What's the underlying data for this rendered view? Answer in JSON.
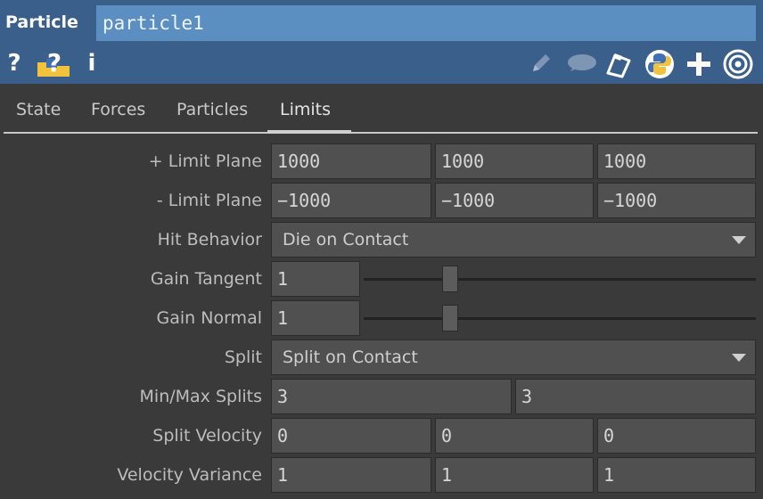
{
  "header": {
    "op_type": "Particle",
    "op_name": "particle1",
    "left_icons": [
      "help-icon",
      "python-help-icon",
      "info-icon"
    ],
    "right_icons": [
      "pencil-icon",
      "comment-icon",
      "clipboard-icon",
      "python-icon",
      "plus-icon",
      "target-icon"
    ],
    "help_glyph": "?",
    "info_glyph": "i"
  },
  "tabs": [
    "State",
    "Forces",
    "Particles",
    "Limits"
  ],
  "active_tab": "Limits",
  "params": {
    "limit_plane_pos": {
      "label": "+ Limit Plane",
      "values": [
        "1000",
        "1000",
        "1000"
      ]
    },
    "limit_plane_neg": {
      "label": "- Limit Plane",
      "values": [
        "−1000",
        "−1000",
        "−1000"
      ]
    },
    "hit_behavior": {
      "label": "Hit Behavior",
      "value": "Die on Contact"
    },
    "gain_tangent": {
      "label": "Gain Tangent",
      "value": "1",
      "slider_fraction": 0.22
    },
    "gain_normal": {
      "label": "Gain Normal",
      "value": "1",
      "slider_fraction": 0.22
    },
    "split": {
      "label": "Split",
      "value": "Split on Contact"
    },
    "min_max_splits": {
      "label": "Min/Max Splits",
      "values": [
        "3",
        "3"
      ]
    },
    "split_velocity": {
      "label": "Split Velocity",
      "values": [
        "0",
        "0",
        "0"
      ]
    },
    "velocity_variance": {
      "label": "Velocity Variance",
      "values": [
        "1",
        "1",
        "1"
      ]
    }
  },
  "colors": {
    "header_bg": "#3a5f8a",
    "name_field_bg": "#5b8fc2",
    "panel_bg": "#3a3a3a",
    "field_bg": "#505050"
  }
}
